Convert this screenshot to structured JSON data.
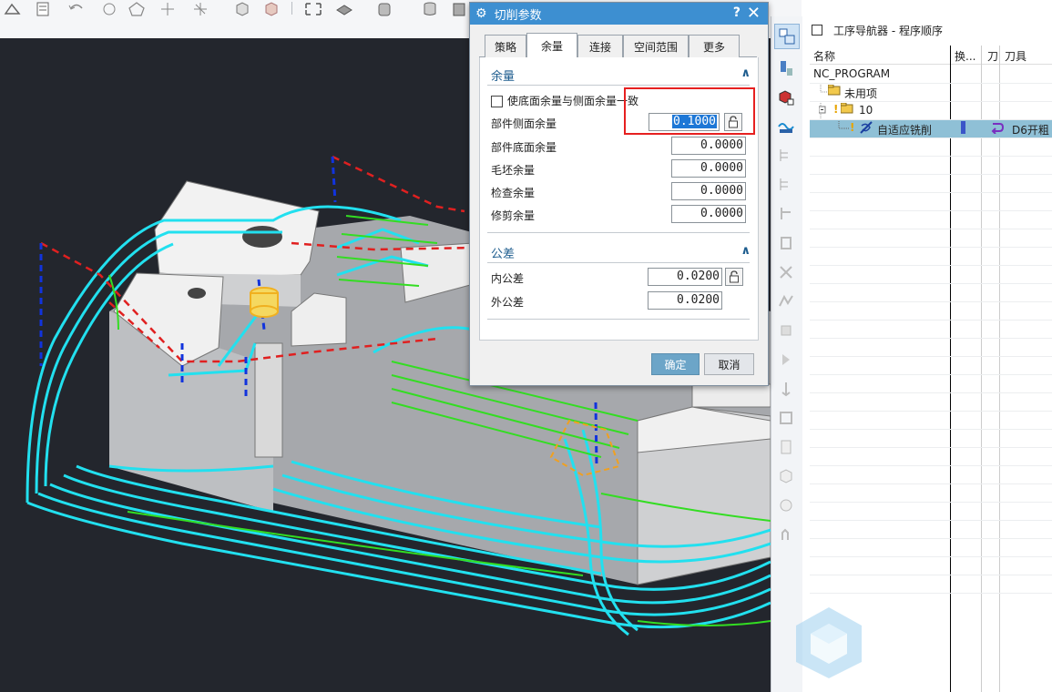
{
  "dialog": {
    "title": "切削参数",
    "help": "?",
    "close": "✕",
    "tabs": [
      {
        "label": "策略",
        "active": false
      },
      {
        "label": "余量",
        "active": true
      },
      {
        "label": "连接",
        "active": false
      },
      {
        "label": "空间范围",
        "active": false
      },
      {
        "label": "更多",
        "active": false
      }
    ],
    "allowance_section": {
      "title": "余量",
      "collapse": "∧",
      "checkbox_label": "使底面余量与侧面余量一致",
      "checkbox_checked": false,
      "fields": [
        {
          "label": "部件侧面余量",
          "value": "0.1000"
        },
        {
          "label": "部件底面余量",
          "value": "0.0000"
        },
        {
          "label": "毛坯余量",
          "value": "0.0000"
        },
        {
          "label": "检查余量",
          "value": "0.0000"
        },
        {
          "label": "修剪余量",
          "value": "0.0000"
        }
      ]
    },
    "tolerance_section": {
      "title": "公差",
      "collapse": "∧",
      "fields": [
        {
          "label": "内公差",
          "value": "0.0200"
        },
        {
          "label": "外公差",
          "value": "0.0200"
        }
      ]
    },
    "ok_label": "确定",
    "cancel_label": "取消"
  },
  "navigator": {
    "title": "工序导航器 - 程序顺序",
    "columns": [
      "名称",
      "换...",
      "刀",
      "刀具"
    ],
    "rows": [
      {
        "name": "NC_PROGRAM",
        "tool": ""
      },
      {
        "name": "未用项",
        "tool": ""
      },
      {
        "name": "10",
        "tool": ""
      },
      {
        "name": "自适应铣削",
        "tool": "D6开粗"
      }
    ]
  },
  "colors": {
    "dialog_title_bar": "#3d8fd1",
    "viewport_bg": "#23262d",
    "toolpath_cyan": "#22e0ef",
    "toolpath_green": "#33dd22",
    "rapid_red": "#e02020",
    "annotation_red": "#e62020"
  }
}
